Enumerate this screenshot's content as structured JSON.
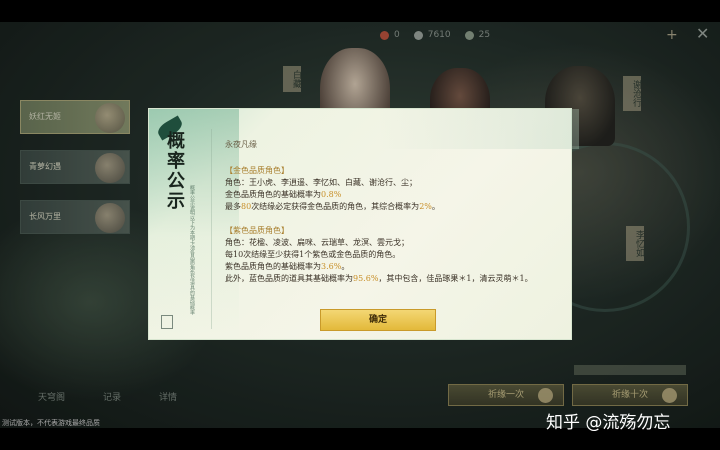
{
  "topbar": {
    "resources": [
      {
        "value": "0",
        "color": "#b9523d"
      },
      {
        "value": "7610",
        "color": "#9aa39d"
      },
      {
        "value": "25",
        "color": "#8c9c8a"
      }
    ],
    "plus": "+"
  },
  "left_banners": [
    "妖红无姬",
    "青萝幻遇",
    "长风万里"
  ],
  "bg_names": [
    "白藏",
    "谢沧行",
    "李忆如"
  ],
  "bottom_tabs": [
    "天穹阁",
    "记录",
    "详情"
  ],
  "notice": "测试版本，不代表游戏最终品质",
  "draw_buttons": [
    "祈缘一次",
    "祈缘十次"
  ],
  "watermark": "知乎 @流殇勿忘",
  "modal": {
    "title": "概率公示",
    "subtitle": "概率公示说明以下为本期卡池各品质角色及道具的基础概率",
    "pool_name": "永夜凡缘",
    "gold_section": "【金色品质角色】",
    "gold_roles": "角色：王小虎、李逍遥、李忆如、白藏、谢沧行、尘；",
    "gold_rate_prefix": "金色品质角色的基础概率为",
    "gold_rate": "0.8%",
    "gold_pity_prefix": "最多",
    "gold_pity_num": "80",
    "gold_pity_suffix": "次结缘必定获得金色品质的角色，其综合概率为",
    "gold_combined": "2%",
    "gold_combined_end": "。",
    "purple_section": "【紫色品质角色】",
    "purple_roles": "角色：花楹、凌波、扁咪、云瑞草、龙溟、雲元戈；",
    "purple_guarantee": "每10次结缘至少获得1个紫色或金色品质的角色。",
    "purple_rate_prefix": "紫色品质角色的基础概率为",
    "purple_rate": "3.6%",
    "purple_rate_end": "。",
    "blue_text_prefix": "此外，蓝色品质的道具其基础概率为",
    "blue_rate": "95.6%",
    "blue_text_suffix": "，其中包含，佳品琢果＊1，清云灵萌＊1。",
    "confirm": "确定"
  }
}
